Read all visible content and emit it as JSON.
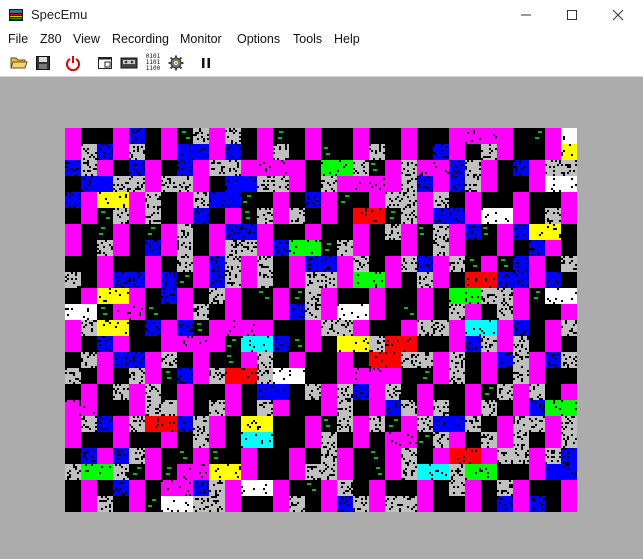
{
  "window": {
    "title": "SpecEmu",
    "controls": [
      "minimize",
      "maximize",
      "close"
    ]
  },
  "menu": {
    "items": [
      "File",
      "Z80",
      "View",
      "Recording",
      "Monitor",
      "Options",
      "Tools",
      "Help"
    ]
  },
  "toolbar": {
    "buttons": [
      {
        "name": "open-file-icon"
      },
      {
        "name": "save-icon"
      },
      {
        "name": "power-icon"
      },
      {
        "name": "window-size-icon"
      },
      {
        "name": "tape-icon"
      },
      {
        "name": "binary-icon",
        "label_lines": [
          "0101",
          "1101",
          "1100"
        ]
      },
      {
        "name": "settings-gear-icon"
      },
      {
        "name": "pause-icon"
      }
    ]
  },
  "emulator": {
    "border_color": "#acacac",
    "paper_color": "#000000",
    "palette": [
      "#ff00ff",
      "#00ff00",
      "#0000ff",
      "#ff0000",
      "#00ffff",
      "#ffff00",
      "#ffffff",
      "#c0c0c0",
      "#0000c0",
      "#c000c0",
      "#00c000",
      "#c00000",
      "#00c0c0",
      "#c0c000"
    ]
  }
}
